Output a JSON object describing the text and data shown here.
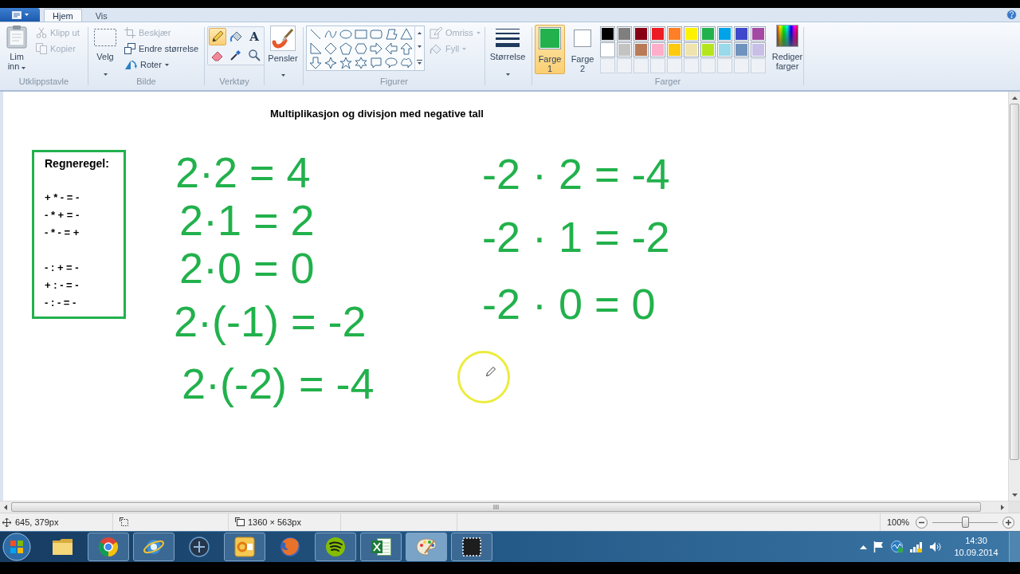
{
  "tabs": [
    {
      "label": "Hjem",
      "selected": true
    },
    {
      "label": "Vis",
      "selected": false
    }
  ],
  "clipboard": {
    "title": "Utklippstavle",
    "paste": "Lim inn",
    "cut": {
      "label": "Klipp ut",
      "disabled": true
    },
    "copy": {
      "label": "Kopier",
      "disabled": true
    }
  },
  "image": {
    "title": "Bilde",
    "select": "Velg",
    "crop": {
      "label": "Beskjær",
      "disabled": true
    },
    "resize": {
      "label": "Endre størrelse",
      "disabled": false
    },
    "rotate": {
      "label": "Roter",
      "disabled": false
    }
  },
  "tools": {
    "title": "Verktøy",
    "items": [
      {
        "kind": "pencil",
        "selected": true
      },
      {
        "kind": "fill",
        "selected": false
      },
      {
        "kind": "text",
        "glyph": "A",
        "selected": false
      },
      {
        "kind": "eraser",
        "selected": false
      },
      {
        "kind": "color-picker",
        "selected": false
      },
      {
        "kind": "magnifier",
        "selected": false
      }
    ]
  },
  "brushes": {
    "label": "Pensler"
  },
  "shapes": {
    "title": "Figurer",
    "outline": {
      "label": "Omriss",
      "disabled": true
    },
    "fill": {
      "label": "Fyll",
      "disabled": true
    }
  },
  "size": {
    "label": "Størrelse"
  },
  "colors": {
    "title": "Farger",
    "color1": {
      "label": "Farge 1",
      "color": "#22b14c",
      "selected": true
    },
    "color2": {
      "label": "Farge 2",
      "color": "#ffffff",
      "selected": false
    },
    "palette": [
      {
        "kind": "swatch",
        "color": "#000000"
      },
      {
        "kind": "swatch",
        "color": "#7f7f7f"
      },
      {
        "kind": "swatch",
        "color": "#880015"
      },
      {
        "kind": "swatch",
        "color": "#ed1c24"
      },
      {
        "kind": "swatch",
        "color": "#ff7f27"
      },
      {
        "kind": "swatch",
        "color": "#fff200"
      },
      {
        "kind": "swatch",
        "color": "#22b14c"
      },
      {
        "kind": "swatch",
        "color": "#00a2e8"
      },
      {
        "kind": "swatch",
        "color": "#3f48cc"
      },
      {
        "kind": "swatch",
        "color": "#a349a4"
      },
      {
        "kind": "swatch",
        "color": "#ffffff"
      },
      {
        "kind": "swatch",
        "color": "#c3c3c3"
      },
      {
        "kind": "swatch",
        "color": "#b97a57"
      },
      {
        "kind": "swatch",
        "color": "#ffaec9"
      },
      {
        "kind": "swatch",
        "color": "#ffc90e"
      },
      {
        "kind": "swatch",
        "color": "#efe4b0"
      },
      {
        "kind": "swatch",
        "color": "#b5e61d"
      },
      {
        "kind": "swatch",
        "color": "#99d9ea"
      },
      {
        "kind": "swatch",
        "color": "#7092be"
      },
      {
        "kind": "swatch",
        "color": "#c8bfe7"
      },
      {
        "kind": "empty"
      },
      {
        "kind": "empty"
      },
      {
        "kind": "empty"
      },
      {
        "kind": "empty"
      },
      {
        "kind": "empty"
      },
      {
        "kind": "empty"
      },
      {
        "kind": "empty"
      },
      {
        "kind": "empty"
      },
      {
        "kind": "empty"
      },
      {
        "kind": "empty"
      }
    ],
    "edit": "Rediger farger"
  },
  "canvas": {
    "title": "Multiplikasjon og divisjon med negative tall",
    "rules": {
      "heading": "Regneregel:",
      "groups": [
        [
          "+ * - = -",
          "- * + = -",
          "- * - = +"
        ],
        [
          "- : + = -",
          "+ : - = -",
          "- : - = -"
        ]
      ]
    },
    "equations_left": [
      "2·2 = 4",
      "2·1 = 2",
      "2·0 = 0",
      "2·(-1) = -2",
      "2·(-2) = -4"
    ],
    "equations_right": [
      "-2 · 2 = -4",
      "-2 · 1 = -2",
      "-2 · 0 = 0"
    ]
  },
  "status_bar": {
    "cursor_position": "645, 379px",
    "canvas_size": "1360 × 563px",
    "zoom": {
      "label": "100%",
      "level": 0.5
    }
  },
  "taskbar": {
    "apps": [
      {
        "kind": "folder",
        "running": false,
        "selected": false
      },
      {
        "kind": "browser-ball",
        "running": true,
        "selected": false
      },
      {
        "kind": "browser-orbit",
        "running": true,
        "selected": false
      },
      {
        "kind": "round-logo",
        "running": false,
        "selected": false
      },
      {
        "kind": "mail",
        "running": true,
        "selected": false
      },
      {
        "kind": "browser-globe",
        "running": false,
        "selected": false
      },
      {
        "kind": "music",
        "running": true,
        "selected": false
      },
      {
        "kind": "spreadsheet",
        "running": true,
        "selected": false
      },
      {
        "kind": "paint",
        "running": true,
        "selected": true
      },
      {
        "kind": "screen-capture",
        "running": true,
        "selected": false
      }
    ],
    "time": "14:30",
    "date": "10.09.2014"
  }
}
